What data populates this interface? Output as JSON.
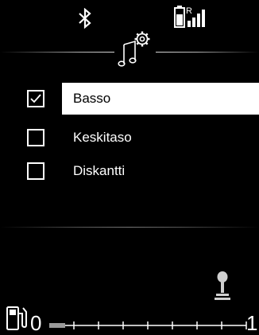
{
  "status": {
    "bluetooth_icon": "bluetooth-icon",
    "battery_icon": "phone-battery-icon",
    "signal_icon": "signal-strength-icon",
    "roaming_indicator": "R"
  },
  "header": {
    "icon": "music-settings-icon"
  },
  "options": [
    {
      "label": "Basso",
      "checked": true,
      "selected": true
    },
    {
      "label": "Keskitaso",
      "checked": false,
      "selected": false
    },
    {
      "label": "Diskantti",
      "checked": false,
      "selected": false
    }
  ],
  "footer": {
    "gearshift_icon": "gearshift-icon",
    "fuel_icon": "fuel-pump-icon",
    "fuel_min": "0",
    "fuel_max": "1",
    "fuel_level": 0.08
  }
}
